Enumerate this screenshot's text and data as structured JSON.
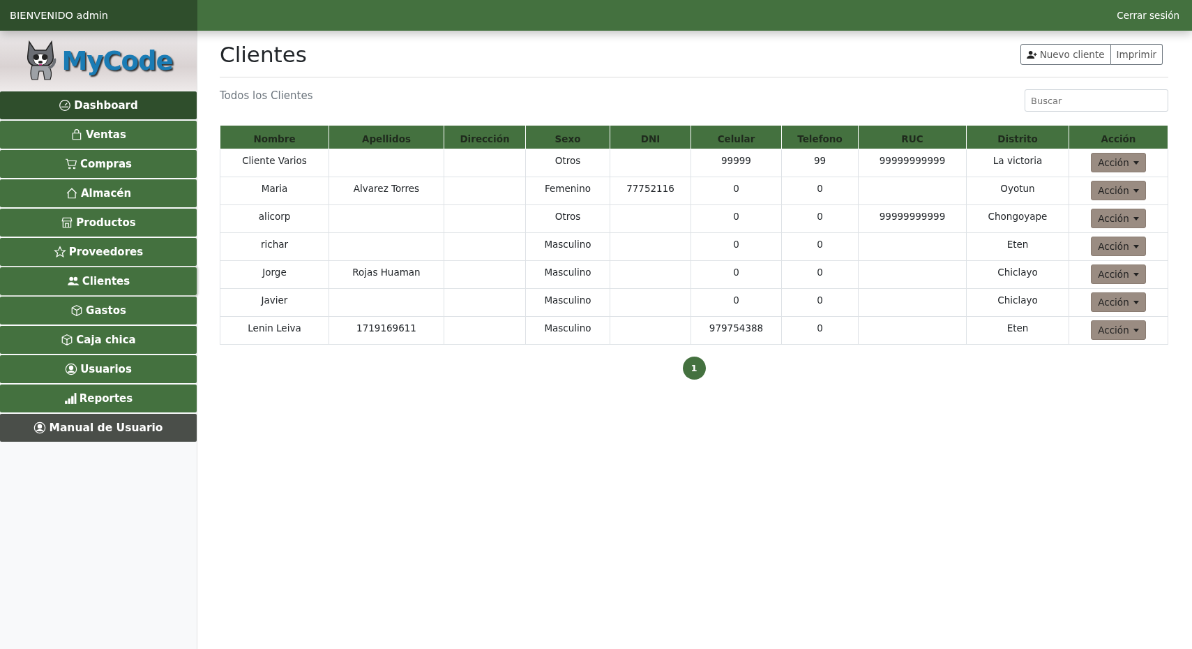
{
  "header": {
    "welcome": "BIENVENIDO admin",
    "logout": "Cerrar sesión"
  },
  "logo": {
    "text": "MyCode"
  },
  "sidebar": {
    "items": [
      {
        "label": "Dashboard",
        "kind": "dark",
        "selected": false
      },
      {
        "label": "Ventas",
        "kind": "normal",
        "selected": false
      },
      {
        "label": "Compras",
        "kind": "normal",
        "selected": false
      },
      {
        "label": "Almacén",
        "kind": "normal",
        "selected": false
      },
      {
        "label": "Productos",
        "kind": "normal",
        "selected": false
      },
      {
        "label": "Proveedores",
        "kind": "normal",
        "selected": false
      },
      {
        "label": "Clientes",
        "kind": "normal",
        "selected": true
      },
      {
        "label": "Gastos",
        "kind": "normal",
        "selected": false
      },
      {
        "label": "Caja chica",
        "kind": "normal",
        "selected": false
      },
      {
        "label": "Usuarios",
        "kind": "normal",
        "selected": false
      },
      {
        "label": "Reportes",
        "kind": "normal",
        "selected": false
      },
      {
        "label": "Manual de Usuario",
        "kind": "grey",
        "selected": false
      }
    ]
  },
  "page": {
    "title": "Clientes",
    "buttons": [
      "Nuevo cliente",
      "Imprimir"
    ],
    "subtitle": "Todos los Clientes",
    "search": {
      "placeholder": "Buscar"
    }
  },
  "table": {
    "columns": [
      "Nombre",
      "Apellidos",
      "Dirección",
      "Sexo",
      "DNI",
      "Celular",
      "Telefono",
      "RUC",
      "Distrito",
      "Acción"
    ],
    "rows": [
      {
        "cells": [
          "Cliente Varios",
          "",
          "",
          "Otros",
          "",
          "99999",
          "99",
          "99999999999",
          "La victoria"
        ],
        "action": "Acción"
      },
      {
        "cells": [
          "Maria",
          "Alvarez Torres",
          "",
          "Femenino",
          "77752116",
          "0",
          "0",
          "",
          "Oyotun"
        ],
        "action": "Acción"
      },
      {
        "cells": [
          "alicorp",
          "",
          "",
          "Otros",
          "",
          "0",
          "0",
          "99999999999",
          "Chongoyape"
        ],
        "action": "Acción"
      },
      {
        "cells": [
          "richar",
          "",
          "",
          "Masculino",
          "",
          "0",
          "0",
          "",
          "Eten"
        ],
        "action": "Acción"
      },
      {
        "cells": [
          "Jorge",
          "Rojas Huaman",
          "",
          "Masculino",
          "",
          "0",
          "0",
          "",
          "Chiclayo"
        ],
        "action": "Acción"
      },
      {
        "cells": [
          "Javier",
          "",
          "",
          "Masculino",
          "",
          "0",
          "0",
          "",
          "Chiclayo"
        ],
        "action": "Acción"
      },
      {
        "cells": [
          "Lenin Leiva",
          "1719169611",
          "",
          "Masculino",
          "",
          "979754388",
          "0",
          "",
          "Eten"
        ],
        "action": "Acción"
      }
    ]
  },
  "pagination": [
    {
      "label": "1",
      "selected": true
    }
  ]
}
